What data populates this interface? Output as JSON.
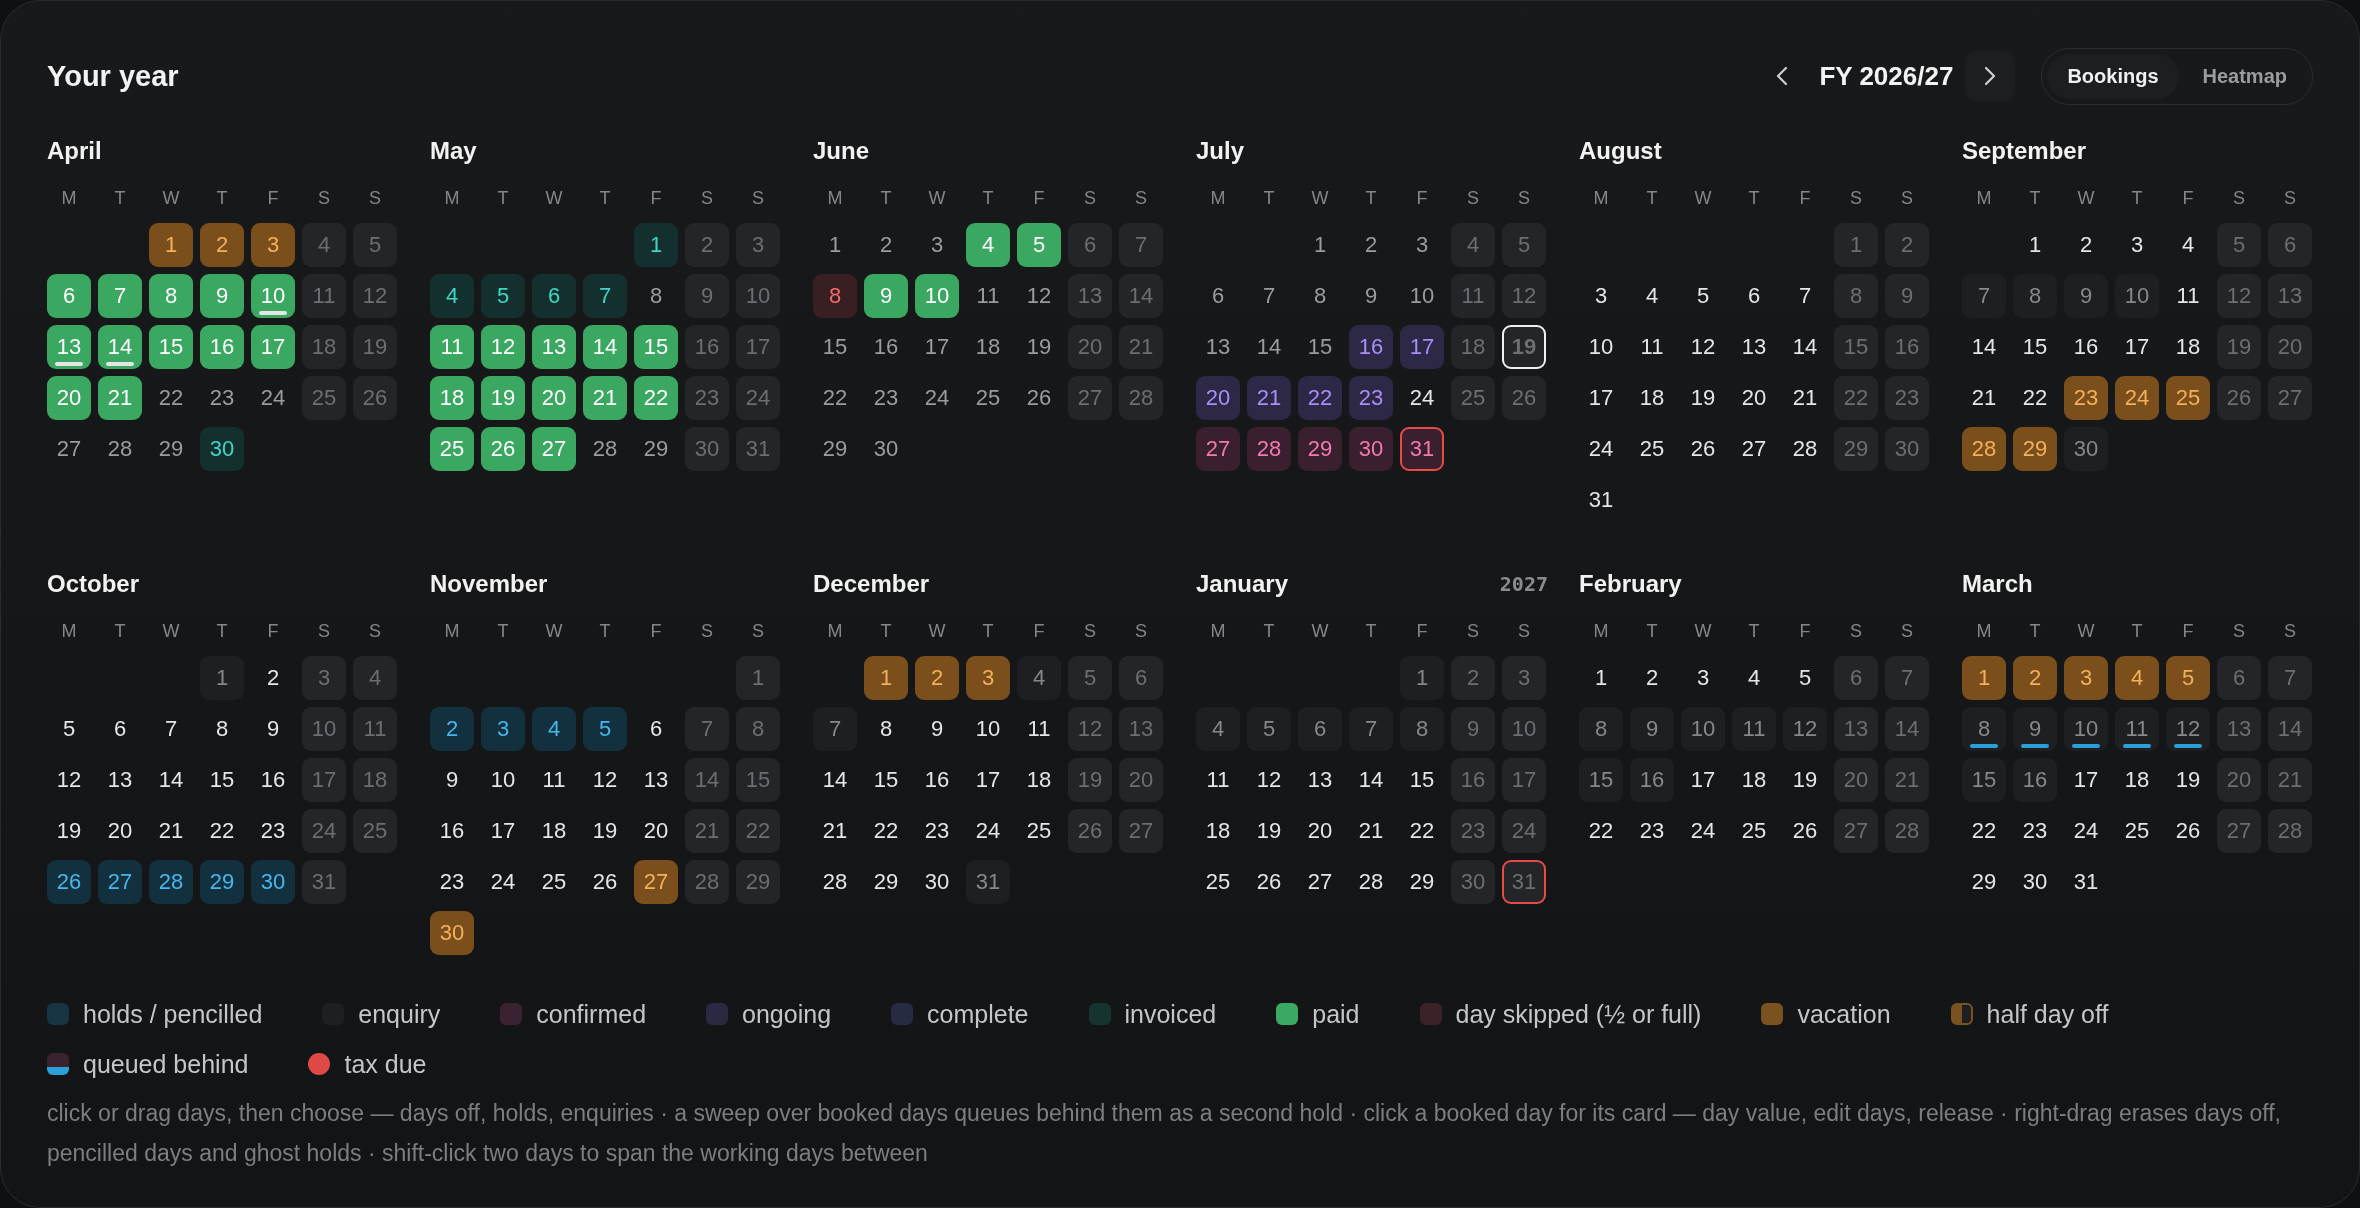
{
  "title": "Your year",
  "fiscal_year": {
    "label": "FY 2026/27"
  },
  "view_tabs": [
    {
      "label": "Bookings",
      "selected": true
    },
    {
      "label": "Heatmap",
      "selected": false
    }
  ],
  "months": [
    {
      "name": "April",
      "weekdays": [
        "M",
        "T",
        "W",
        "T",
        "F",
        "S",
        "S"
      ],
      "weeks": [
        [
          {
            "day": "1",
            "kind": "vacation"
          },
          {
            "day": "2",
            "kind": "vacation"
          },
          {
            "day": "3",
            "kind": "vacation"
          },
          {
            "day": "4",
            "kind": "weekend"
          },
          {
            "day": "5",
            "kind": "weekend"
          }
        ],
        [
          {
            "day": "6",
            "kind": "paid"
          },
          {
            "day": "7",
            "kind": "paid"
          },
          {
            "day": "8",
            "kind": "paid"
          },
          {
            "day": "9",
            "kind": "paid"
          },
          {
            "day": "10",
            "kind": "paid",
            "underlined": true
          },
          {
            "day": "11",
            "kind": "weekend"
          },
          {
            "day": "12",
            "kind": "weekend"
          }
        ],
        [
          {
            "day": "13",
            "kind": "paid",
            "underlined": true
          },
          {
            "day": "14",
            "kind": "paid",
            "underlined": true
          },
          {
            "day": "15",
            "kind": "paid"
          },
          {
            "day": "16",
            "kind": "paid"
          },
          {
            "day": "17",
            "kind": "paid"
          },
          {
            "day": "18",
            "kind": "weekend"
          },
          {
            "day": "19",
            "kind": "weekend"
          }
        ],
        [
          {
            "day": "20",
            "kind": "paid"
          },
          {
            "day": "21",
            "kind": "paid"
          },
          {
            "day": "22",
            "kind": "past"
          },
          {
            "day": "23",
            "kind": "past"
          },
          {
            "day": "24",
            "kind": "past"
          },
          {
            "day": "25",
            "kind": "weekend"
          },
          {
            "day": "26",
            "kind": "weekend"
          }
        ],
        [
          {
            "day": "27",
            "kind": "past"
          },
          {
            "day": "28",
            "kind": "past"
          },
          {
            "day": "29",
            "kind": "past"
          },
          {
            "day": "30",
            "kind": "invoiced"
          }
        ]
      ]
    },
    {
      "name": "May",
      "weekdays": [
        "M",
        "T",
        "W",
        "T",
        "F",
        "S",
        "S"
      ],
      "weeks": [
        [
          {
            "day": "1",
            "kind": "invoiced"
          },
          {
            "day": "2",
            "kind": "weekend"
          },
          {
            "day": "3",
            "kind": "weekend"
          }
        ],
        [
          {
            "day": "4",
            "kind": "invoiced"
          },
          {
            "day": "5",
            "kind": "invoiced"
          },
          {
            "day": "6",
            "kind": "invoiced"
          },
          {
            "day": "7",
            "kind": "invoiced"
          },
          {
            "day": "8",
            "kind": "past"
          },
          {
            "day": "9",
            "kind": "weekend"
          },
          {
            "day": "10",
            "kind": "weekend"
          }
        ],
        [
          {
            "day": "11",
            "kind": "paid"
          },
          {
            "day": "12",
            "kind": "paid"
          },
          {
            "day": "13",
            "kind": "paid"
          },
          {
            "day": "14",
            "kind": "paid"
          },
          {
            "day": "15",
            "kind": "paid"
          },
          {
            "day": "16",
            "kind": "weekend"
          },
          {
            "day": "17",
            "kind": "weekend"
          }
        ],
        [
          {
            "day": "18",
            "kind": "paid"
          },
          {
            "day": "19",
            "kind": "paid"
          },
          {
            "day": "20",
            "kind": "paid"
          },
          {
            "day": "21",
            "kind": "paid"
          },
          {
            "day": "22",
            "kind": "paid"
          },
          {
            "day": "23",
            "kind": "weekend"
          },
          {
            "day": "24",
            "kind": "weekend"
          }
        ],
        [
          {
            "day": "25",
            "kind": "paid"
          },
          {
            "day": "26",
            "kind": "paid"
          },
          {
            "day": "27",
            "kind": "paid"
          },
          {
            "day": "28",
            "kind": "past"
          },
          {
            "day": "29",
            "kind": "past"
          },
          {
            "day": "30",
            "kind": "weekend"
          },
          {
            "day": "31",
            "kind": "weekend"
          }
        ]
      ]
    },
    {
      "name": "June",
      "weekdays": [
        "M",
        "T",
        "W",
        "T",
        "F",
        "S",
        "S"
      ],
      "weeks": [
        [
          {
            "day": "1",
            "kind": "past"
          },
          {
            "day": "2",
            "kind": "past"
          },
          {
            "day": "3",
            "kind": "past"
          },
          {
            "day": "4",
            "kind": "paid"
          },
          {
            "day": "5",
            "kind": "paid"
          },
          {
            "day": "6",
            "kind": "weekend"
          },
          {
            "day": "7",
            "kind": "weekend"
          }
        ],
        [
          {
            "day": "8",
            "kind": "skipped"
          },
          {
            "day": "9",
            "kind": "paid"
          },
          {
            "day": "10",
            "kind": "paid"
          },
          {
            "day": "11",
            "kind": "past"
          },
          {
            "day": "12",
            "kind": "past"
          },
          {
            "day": "13",
            "kind": "weekend"
          },
          {
            "day": "14",
            "kind": "weekend"
          }
        ],
        [
          {
            "day": "15",
            "kind": "past"
          },
          {
            "day": "16",
            "kind": "past"
          },
          {
            "day": "17",
            "kind": "past"
          },
          {
            "day": "18",
            "kind": "past"
          },
          {
            "day": "19",
            "kind": "past"
          },
          {
            "day": "20",
            "kind": "weekend"
          },
          {
            "day": "21",
            "kind": "weekend"
          }
        ],
        [
          {
            "day": "22",
            "kind": "past"
          },
          {
            "day": "23",
            "kind": "past"
          },
          {
            "day": "24",
            "kind": "past"
          },
          {
            "day": "25",
            "kind": "past"
          },
          {
            "day": "26",
            "kind": "past"
          },
          {
            "day": "27",
            "kind": "weekend"
          },
          {
            "day": "28",
            "kind": "weekend"
          }
        ],
        [
          {
            "day": "29",
            "kind": "past"
          },
          {
            "day": "30",
            "kind": "past"
          }
        ]
      ]
    },
    {
      "name": "July",
      "weekdays": [
        "M",
        "T",
        "W",
        "T",
        "F",
        "S",
        "S"
      ],
      "weeks": [
        [
          {
            "day": "1",
            "kind": "past"
          },
          {
            "day": "2",
            "kind": "past"
          },
          {
            "day": "3",
            "kind": "past"
          },
          {
            "day": "4",
            "kind": "weekend"
          },
          {
            "day": "5",
            "kind": "weekend"
          }
        ],
        [
          {
            "day": "6",
            "kind": "past"
          },
          {
            "day": "7",
            "kind": "past"
          },
          {
            "day": "8",
            "kind": "past"
          },
          {
            "day": "9",
            "kind": "past"
          },
          {
            "day": "10",
            "kind": "past"
          },
          {
            "day": "11",
            "kind": "weekend"
          },
          {
            "day": "12",
            "kind": "weekend"
          }
        ],
        [
          {
            "day": "13",
            "kind": "past"
          },
          {
            "day": "14",
            "kind": "past"
          },
          {
            "day": "15",
            "kind": "past"
          },
          {
            "day": "16",
            "kind": "ongoing"
          },
          {
            "day": "17",
            "kind": "ongoing"
          },
          {
            "day": "18",
            "kind": "weekend"
          },
          {
            "day": "19",
            "kind": "weekend",
            "today": true
          }
        ],
        [
          {
            "day": "20",
            "kind": "ongoing"
          },
          {
            "day": "21",
            "kind": "ongoing"
          },
          {
            "day": "22",
            "kind": "ongoing"
          },
          {
            "day": "23",
            "kind": "ongoing"
          },
          {
            "day": "24",
            "kind": "plain"
          },
          {
            "day": "25",
            "kind": "weekend"
          },
          {
            "day": "26",
            "kind": "weekend"
          }
        ],
        [
          {
            "day": "27",
            "kind": "confirmed"
          },
          {
            "day": "28",
            "kind": "confirmed"
          },
          {
            "day": "29",
            "kind": "confirmed"
          },
          {
            "day": "30",
            "kind": "confirmed"
          },
          {
            "day": "31",
            "kind": "confirmed",
            "tax_due": true
          }
        ]
      ]
    },
    {
      "name": "August",
      "weekdays": [
        "M",
        "T",
        "W",
        "T",
        "F",
        "S",
        "S"
      ],
      "weeks": [
        [
          {
            "day": "1",
            "kind": "weekend"
          },
          {
            "day": "2",
            "kind": "weekend"
          }
        ],
        [
          {
            "day": "3",
            "kind": "plain"
          },
          {
            "day": "4",
            "kind": "plain"
          },
          {
            "day": "5",
            "kind": "plain"
          },
          {
            "day": "6",
            "kind": "plain"
          },
          {
            "day": "7",
            "kind": "plain"
          },
          {
            "day": "8",
            "kind": "weekend"
          },
          {
            "day": "9",
            "kind": "weekend"
          }
        ],
        [
          {
            "day": "10",
            "kind": "plain"
          },
          {
            "day": "11",
            "kind": "plain"
          },
          {
            "day": "12",
            "kind": "plain"
          },
          {
            "day": "13",
            "kind": "plain"
          },
          {
            "day": "14",
            "kind": "plain"
          },
          {
            "day": "15",
            "kind": "weekend"
          },
          {
            "day": "16",
            "kind": "weekend"
          }
        ],
        [
          {
            "day": "17",
            "kind": "plain"
          },
          {
            "day": "18",
            "kind": "plain"
          },
          {
            "day": "19",
            "kind": "plain"
          },
          {
            "day": "20",
            "kind": "plain"
          },
          {
            "day": "21",
            "kind": "plain"
          },
          {
            "day": "22",
            "kind": "weekend"
          },
          {
            "day": "23",
            "kind": "weekend"
          }
        ],
        [
          {
            "day": "24",
            "kind": "plain"
          },
          {
            "day": "25",
            "kind": "plain"
          },
          {
            "day": "26",
            "kind": "plain"
          },
          {
            "day": "27",
            "kind": "plain"
          },
          {
            "day": "28",
            "kind": "plain"
          },
          {
            "day": "29",
            "kind": "weekend"
          },
          {
            "day": "30",
            "kind": "weekend"
          }
        ],
        [
          {
            "day": "31",
            "kind": "plain"
          }
        ]
      ]
    },
    {
      "name": "September",
      "weekdays": [
        "M",
        "T",
        "W",
        "T",
        "F",
        "S",
        "S"
      ],
      "weeks": [
        [
          {
            "day": "1",
            "kind": "plain"
          },
          {
            "day": "2",
            "kind": "plain"
          },
          {
            "day": "3",
            "kind": "plain"
          },
          {
            "day": "4",
            "kind": "plain"
          },
          {
            "day": "5",
            "kind": "weekend"
          },
          {
            "day": "6",
            "kind": "weekend"
          }
        ],
        [
          {
            "day": "7",
            "kind": "enquiry"
          },
          {
            "day": "8",
            "kind": "enquiry"
          },
          {
            "day": "9",
            "kind": "enquiry"
          },
          {
            "day": "10",
            "kind": "enquiry"
          },
          {
            "day": "11",
            "kind": "plain"
          },
          {
            "day": "12",
            "kind": "weekend"
          },
          {
            "day": "13",
            "kind": "weekend"
          }
        ],
        [
          {
            "day": "14",
            "kind": "plain"
          },
          {
            "day": "15",
            "kind": "plain"
          },
          {
            "day": "16",
            "kind": "plain"
          },
          {
            "day": "17",
            "kind": "plain"
          },
          {
            "day": "18",
            "kind": "plain"
          },
          {
            "day": "19",
            "kind": "weekend"
          },
          {
            "day": "20",
            "kind": "weekend"
          }
        ],
        [
          {
            "day": "21",
            "kind": "plain"
          },
          {
            "day": "22",
            "kind": "plain"
          },
          {
            "day": "23",
            "kind": "vacation"
          },
          {
            "day": "24",
            "kind": "vacation"
          },
          {
            "day": "25",
            "kind": "vacation"
          },
          {
            "day": "26",
            "kind": "weekend"
          },
          {
            "day": "27",
            "kind": "weekend"
          }
        ],
        [
          {
            "day": "28",
            "kind": "vacation"
          },
          {
            "day": "29",
            "kind": "vacation"
          },
          {
            "day": "30",
            "kind": "enquiry"
          }
        ]
      ]
    },
    {
      "name": "October",
      "weekdays": [
        "M",
        "T",
        "W",
        "T",
        "F",
        "S",
        "S"
      ],
      "weeks": [
        [
          {
            "day": "1",
            "kind": "enquiry"
          },
          {
            "day": "2",
            "kind": "plain"
          },
          {
            "day": "3",
            "kind": "weekend"
          },
          {
            "day": "4",
            "kind": "weekend"
          }
        ],
        [
          {
            "day": "5",
            "kind": "plain"
          },
          {
            "day": "6",
            "kind": "plain"
          },
          {
            "day": "7",
            "kind": "plain"
          },
          {
            "day": "8",
            "kind": "plain"
          },
          {
            "day": "9",
            "kind": "plain"
          },
          {
            "day": "10",
            "kind": "weekend"
          },
          {
            "day": "11",
            "kind": "weekend"
          }
        ],
        [
          {
            "day": "12",
            "kind": "plain"
          },
          {
            "day": "13",
            "kind": "plain"
          },
          {
            "day": "14",
            "kind": "plain"
          },
          {
            "day": "15",
            "kind": "plain"
          },
          {
            "day": "16",
            "kind": "plain"
          },
          {
            "day": "17",
            "kind": "weekend"
          },
          {
            "day": "18",
            "kind": "weekend"
          }
        ],
        [
          {
            "day": "19",
            "kind": "plain"
          },
          {
            "day": "20",
            "kind": "plain"
          },
          {
            "day": "21",
            "kind": "plain"
          },
          {
            "day": "22",
            "kind": "plain"
          },
          {
            "day": "23",
            "kind": "plain"
          },
          {
            "day": "24",
            "kind": "weekend"
          },
          {
            "day": "25",
            "kind": "weekend"
          }
        ],
        [
          {
            "day": "26",
            "kind": "hold"
          },
          {
            "day": "27",
            "kind": "hold"
          },
          {
            "day": "28",
            "kind": "hold"
          },
          {
            "day": "29",
            "kind": "hold"
          },
          {
            "day": "30",
            "kind": "hold"
          },
          {
            "day": "31",
            "kind": "weekend"
          }
        ]
      ]
    },
    {
      "name": "November",
      "weekdays": [
        "M",
        "T",
        "W",
        "T",
        "F",
        "S",
        "S"
      ],
      "weeks": [
        [
          {
            "day": "1",
            "kind": "weekend"
          }
        ],
        [
          {
            "day": "2",
            "kind": "hold"
          },
          {
            "day": "3",
            "kind": "hold"
          },
          {
            "day": "4",
            "kind": "hold"
          },
          {
            "day": "5",
            "kind": "hold"
          },
          {
            "day": "6",
            "kind": "plain"
          },
          {
            "day": "7",
            "kind": "weekend"
          },
          {
            "day": "8",
            "kind": "weekend"
          }
        ],
        [
          {
            "day": "9",
            "kind": "plain"
          },
          {
            "day": "10",
            "kind": "plain"
          },
          {
            "day": "11",
            "kind": "plain"
          },
          {
            "day": "12",
            "kind": "plain"
          },
          {
            "day": "13",
            "kind": "plain"
          },
          {
            "day": "14",
            "kind": "weekend"
          },
          {
            "day": "15",
            "kind": "weekend"
          }
        ],
        [
          {
            "day": "16",
            "kind": "plain"
          },
          {
            "day": "17",
            "kind": "plain"
          },
          {
            "day": "18",
            "kind": "plain"
          },
          {
            "day": "19",
            "kind": "plain"
          },
          {
            "day": "20",
            "kind": "plain"
          },
          {
            "day": "21",
            "kind": "weekend"
          },
          {
            "day": "22",
            "kind": "weekend"
          }
        ],
        [
          {
            "day": "23",
            "kind": "plain"
          },
          {
            "day": "24",
            "kind": "plain"
          },
          {
            "day": "25",
            "kind": "plain"
          },
          {
            "day": "26",
            "kind": "plain"
          },
          {
            "day": "27",
            "kind": "vacation"
          },
          {
            "day": "28",
            "kind": "weekend"
          },
          {
            "day": "29",
            "kind": "weekend"
          }
        ],
        [
          {
            "day": "30",
            "kind": "vacation"
          }
        ]
      ]
    },
    {
      "name": "December",
      "weekdays": [
        "M",
        "T",
        "W",
        "T",
        "F",
        "S",
        "S"
      ],
      "weeks": [
        [
          {
            "day": "1",
            "kind": "vacation"
          },
          {
            "day": "2",
            "kind": "vacation"
          },
          {
            "day": "3",
            "kind": "vacation"
          },
          {
            "day": "4",
            "kind": "enquiry"
          },
          {
            "day": "5",
            "kind": "weekend"
          },
          {
            "day": "6",
            "kind": "weekend"
          }
        ],
        [
          {
            "day": "7",
            "kind": "enquiry"
          },
          {
            "day": "8",
            "kind": "plain"
          },
          {
            "day": "9",
            "kind": "plain"
          },
          {
            "day": "10",
            "kind": "plain"
          },
          {
            "day": "11",
            "kind": "plain"
          },
          {
            "day": "12",
            "kind": "weekend"
          },
          {
            "day": "13",
            "kind": "weekend"
          }
        ],
        [
          {
            "day": "14",
            "kind": "plain"
          },
          {
            "day": "15",
            "kind": "plain"
          },
          {
            "day": "16",
            "kind": "plain"
          },
          {
            "day": "17",
            "kind": "plain"
          },
          {
            "day": "18",
            "kind": "plain"
          },
          {
            "day": "19",
            "kind": "weekend"
          },
          {
            "day": "20",
            "kind": "weekend"
          }
        ],
        [
          {
            "day": "21",
            "kind": "plain"
          },
          {
            "day": "22",
            "kind": "plain"
          },
          {
            "day": "23",
            "kind": "plain"
          },
          {
            "day": "24",
            "kind": "plain"
          },
          {
            "day": "25",
            "kind": "plain"
          },
          {
            "day": "26",
            "kind": "weekend"
          },
          {
            "day": "27",
            "kind": "weekend"
          }
        ],
        [
          {
            "day": "28",
            "kind": "plain"
          },
          {
            "day": "29",
            "kind": "plain"
          },
          {
            "day": "30",
            "kind": "plain"
          },
          {
            "day": "31",
            "kind": "enquiry"
          }
        ]
      ]
    },
    {
      "name": "January",
      "year": "2027",
      "weekdays": [
        "M",
        "T",
        "W",
        "T",
        "F",
        "S",
        "S"
      ],
      "weeks": [
        [
          {
            "day": "1",
            "kind": "enquiry"
          },
          {
            "day": "2",
            "kind": "weekend"
          },
          {
            "day": "3",
            "kind": "weekend"
          }
        ],
        [
          {
            "day": "4",
            "kind": "enquiry"
          },
          {
            "day": "5",
            "kind": "enquiry"
          },
          {
            "day": "6",
            "kind": "enquiry"
          },
          {
            "day": "7",
            "kind": "enquiry"
          },
          {
            "day": "8",
            "kind": "enquiry"
          },
          {
            "day": "9",
            "kind": "weekend"
          },
          {
            "day": "10",
            "kind": "weekend"
          }
        ],
        [
          {
            "day": "11",
            "kind": "plain"
          },
          {
            "day": "12",
            "kind": "plain"
          },
          {
            "day": "13",
            "kind": "plain"
          },
          {
            "day": "14",
            "kind": "plain"
          },
          {
            "day": "15",
            "kind": "plain"
          },
          {
            "day": "16",
            "kind": "weekend"
          },
          {
            "day": "17",
            "kind": "weekend"
          }
        ],
        [
          {
            "day": "18",
            "kind": "plain"
          },
          {
            "day": "19",
            "kind": "plain"
          },
          {
            "day": "20",
            "kind": "plain"
          },
          {
            "day": "21",
            "kind": "plain"
          },
          {
            "day": "22",
            "kind": "plain"
          },
          {
            "day": "23",
            "kind": "weekend"
          },
          {
            "day": "24",
            "kind": "weekend"
          }
        ],
        [
          {
            "day": "25",
            "kind": "plain"
          },
          {
            "day": "26",
            "kind": "plain"
          },
          {
            "day": "27",
            "kind": "plain"
          },
          {
            "day": "28",
            "kind": "plain"
          },
          {
            "day": "29",
            "kind": "plain"
          },
          {
            "day": "30",
            "kind": "weekend"
          },
          {
            "day": "31",
            "kind": "weekend",
            "tax_due": true
          }
        ]
      ]
    },
    {
      "name": "February",
      "weekdays": [
        "M",
        "T",
        "W",
        "T",
        "F",
        "S",
        "S"
      ],
      "weeks": [
        [
          {
            "day": "1",
            "kind": "plain"
          },
          {
            "day": "2",
            "kind": "plain"
          },
          {
            "day": "3",
            "kind": "plain"
          },
          {
            "day": "4",
            "kind": "plain"
          },
          {
            "day": "5",
            "kind": "plain"
          },
          {
            "day": "6",
            "kind": "weekend"
          },
          {
            "day": "7",
            "kind": "weekend"
          }
        ],
        [
          {
            "day": "8",
            "kind": "enquiry"
          },
          {
            "day": "9",
            "kind": "enquiry"
          },
          {
            "day": "10",
            "kind": "enquiry"
          },
          {
            "day": "11",
            "kind": "enquiry"
          },
          {
            "day": "12",
            "kind": "enquiry"
          },
          {
            "day": "13",
            "kind": "weekend"
          },
          {
            "day": "14",
            "kind": "weekend"
          }
        ],
        [
          {
            "day": "15",
            "kind": "enquiry"
          },
          {
            "day": "16",
            "kind": "enquiry"
          },
          {
            "day": "17",
            "kind": "plain"
          },
          {
            "day": "18",
            "kind": "plain"
          },
          {
            "day": "19",
            "kind": "plain"
          },
          {
            "day": "20",
            "kind": "weekend"
          },
          {
            "day": "21",
            "kind": "weekend"
          }
        ],
        [
          {
            "day": "22",
            "kind": "plain"
          },
          {
            "day": "23",
            "kind": "plain"
          },
          {
            "day": "24",
            "kind": "plain"
          },
          {
            "day": "25",
            "kind": "plain"
          },
          {
            "day": "26",
            "kind": "plain"
          },
          {
            "day": "27",
            "kind": "weekend"
          },
          {
            "day": "28",
            "kind": "weekend"
          }
        ]
      ]
    },
    {
      "name": "March",
      "weekdays": [
        "M",
        "T",
        "W",
        "T",
        "F",
        "S",
        "S"
      ],
      "weeks": [
        [
          {
            "day": "1",
            "kind": "vacation"
          },
          {
            "day": "2",
            "kind": "vacation"
          },
          {
            "day": "3",
            "kind": "vacation"
          },
          {
            "day": "4",
            "kind": "vacation"
          },
          {
            "day": "5",
            "kind": "vacation"
          },
          {
            "day": "6",
            "kind": "weekend"
          },
          {
            "day": "7",
            "kind": "weekend"
          }
        ],
        [
          {
            "day": "8",
            "kind": "enquiry",
            "queued": true
          },
          {
            "day": "9",
            "kind": "enquiry",
            "queued": true
          },
          {
            "day": "10",
            "kind": "enquiry",
            "queued": true
          },
          {
            "day": "11",
            "kind": "enquiry",
            "queued": true
          },
          {
            "day": "12",
            "kind": "enquiry",
            "queued": true
          },
          {
            "day": "13",
            "kind": "weekend"
          },
          {
            "day": "14",
            "kind": "weekend"
          }
        ],
        [
          {
            "day": "15",
            "kind": "enquiry"
          },
          {
            "day": "16",
            "kind": "enquiry"
          },
          {
            "day": "17",
            "kind": "plain"
          },
          {
            "day": "18",
            "kind": "plain"
          },
          {
            "day": "19",
            "kind": "plain"
          },
          {
            "day": "20",
            "kind": "weekend"
          },
          {
            "day": "21",
            "kind": "weekend"
          }
        ],
        [
          {
            "day": "22",
            "kind": "plain"
          },
          {
            "day": "23",
            "kind": "plain"
          },
          {
            "day": "24",
            "kind": "plain"
          },
          {
            "day": "25",
            "kind": "plain"
          },
          {
            "day": "26",
            "kind": "plain"
          },
          {
            "day": "27",
            "kind": "weekend"
          },
          {
            "day": "28",
            "kind": "weekend"
          }
        ],
        [
          {
            "day": "29",
            "kind": "plain"
          },
          {
            "day": "30",
            "kind": "plain"
          },
          {
            "day": "31",
            "kind": "plain"
          }
        ]
      ]
    }
  ],
  "legend": [
    {
      "kind": "swatch",
      "label": "holds / pencilled",
      "color": "#163441"
    },
    {
      "kind": "swatch",
      "label": "enquiry",
      "color": "#1e1f22"
    },
    {
      "kind": "swatch",
      "label": "confirmed",
      "color": "#3a2230"
    },
    {
      "kind": "swatch",
      "label": "ongoing",
      "color": "#2b2842"
    },
    {
      "kind": "swatch",
      "label": "complete",
      "color": "#262a42"
    },
    {
      "kind": "swatch",
      "label": "invoiced",
      "color": "#16332f"
    },
    {
      "kind": "swatch",
      "label": "paid",
      "color": "#3aaa62"
    },
    {
      "kind": "swatch",
      "label": "day skipped (½ or full)",
      "color": "#3a2226"
    },
    {
      "kind": "swatch",
      "label": "vacation",
      "color": "#7a5220"
    },
    {
      "kind": "half",
      "label": "half day off",
      "color": "#7a5220"
    },
    {
      "kind": "queued",
      "label": "queued behind",
      "color": "#3a2230"
    },
    {
      "kind": "dot",
      "label": "tax due",
      "color": "#e04848"
    }
  ],
  "help_text": "click or drag days, then choose — days off, holds, enquiries · a sweep over booked days queues behind them as a second hold · click a booked day for its card — day value, edit days, release · right-drag erases days off, pencilled days and ghost holds · shift-click two days to span the working days between"
}
